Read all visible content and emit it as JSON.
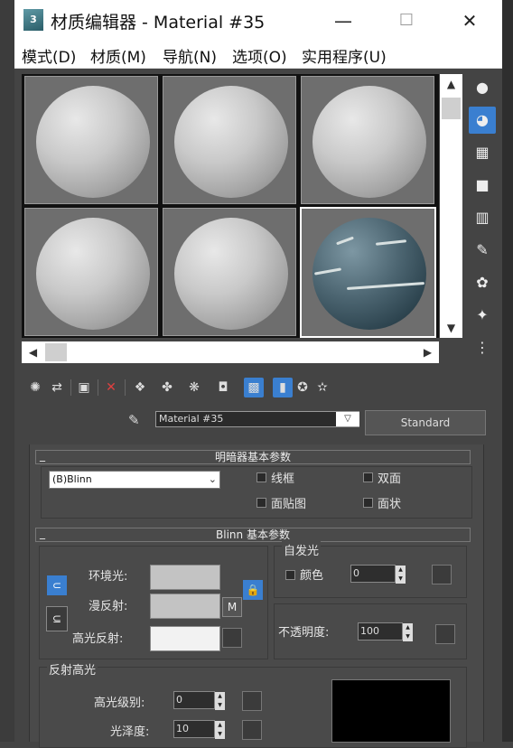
{
  "window": {
    "title": "材质编辑器 - Material #35",
    "logo_text": "3",
    "minimize": "—",
    "maximize": "☐",
    "close": "✕"
  },
  "menu": [
    "模式(D)",
    "材质(M)",
    "导航(N)",
    "选项(O)",
    "实用程序(U)"
  ],
  "material": {
    "name": "Material #35",
    "type_button": "Standard"
  },
  "shader_basic": {
    "header": "明暗器基本参数",
    "shader": "(B)Blinn",
    "wire": "线框",
    "two_sided": "双面",
    "face_map": "面贴图",
    "faceted": "面状"
  },
  "blinn_basic": {
    "header": "Blinn 基本参数",
    "ambient": "环境光:",
    "diffuse": "漫反射:",
    "specular": "高光反射:",
    "map_button": "M",
    "self_illum_title": "自发光",
    "color_label": "颜色",
    "self_illum_value": "0",
    "opacity_label": "不透明度:",
    "opacity_value": "100",
    "ambient_color": "#c3c3c3",
    "diffuse_color": "#c3c3c3",
    "specular_color": "#f2f2f2"
  },
  "specular_highlights": {
    "title": "反射高光",
    "level_label": "高光级别:",
    "level_value": "0",
    "gloss_label": "光泽度:",
    "gloss_value": "10"
  },
  "scroll": {
    "up": "▲",
    "down": "▼",
    "left": "◀",
    "right": "▶"
  },
  "colors": {
    "accent": "#3a7fd0",
    "panel": "#4a4a4a"
  }
}
